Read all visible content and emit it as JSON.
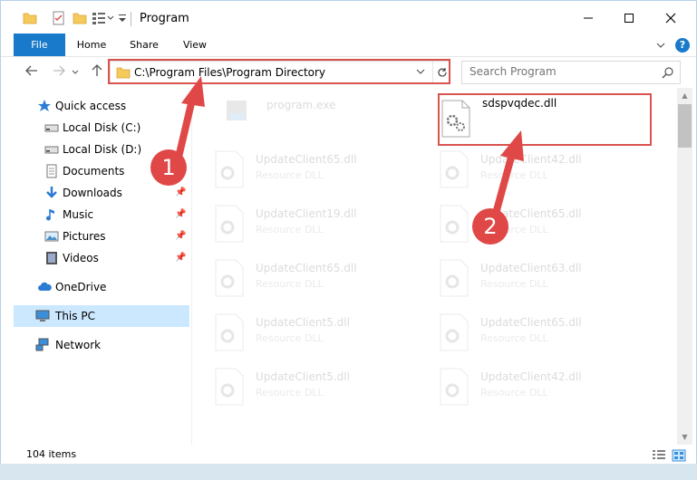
{
  "window": {
    "title": "Program"
  },
  "ribbon": {
    "tabs": [
      {
        "label": "File"
      },
      {
        "label": "Home"
      },
      {
        "label": "Share"
      },
      {
        "label": "View"
      }
    ],
    "help": "?"
  },
  "nav": {
    "address": "C:\\Program Files\\Program Directory",
    "search_placeholder": "Search Program"
  },
  "sidebar": {
    "items": [
      {
        "label": "Quick access",
        "icon": "star-icon"
      },
      {
        "label": "Local Disk (C:)",
        "icon": "drive-icon"
      },
      {
        "label": "Local Disk (D:)",
        "icon": "drive-icon"
      },
      {
        "label": "Documents",
        "icon": "documents-icon"
      },
      {
        "label": "Downloads",
        "icon": "download-icon"
      },
      {
        "label": "Music",
        "icon": "music-icon"
      },
      {
        "label": "Pictures",
        "icon": "pictures-icon"
      },
      {
        "label": "Videos",
        "icon": "videos-icon"
      },
      {
        "label": "OneDrive",
        "icon": "cloud-icon"
      },
      {
        "label": "This PC",
        "icon": "computer-icon"
      },
      {
        "label": "Network",
        "icon": "network-icon"
      }
    ]
  },
  "files": [
    {
      "name": "program.exe",
      "type": ""
    },
    {
      "name": "sdspvqdec.dll",
      "type": ""
    },
    {
      "name": "UpdateClient65.dll",
      "type": "Resource DLL"
    },
    {
      "name": "UpdateClient42.dll",
      "type": "Resource DLL"
    },
    {
      "name": "UpdateClient19.dll",
      "type": "Resource DLL"
    },
    {
      "name": "UpdateClient65.dll",
      "type": "Resource DLL"
    },
    {
      "name": "UpdateClient65.dll",
      "type": "Resource DLL"
    },
    {
      "name": "UpdateClient63.dll",
      "type": "Resource DLL"
    },
    {
      "name": "UpdateClient5.dll",
      "type": "Resource DLL"
    },
    {
      "name": "UpdateClient65.dll",
      "type": "Resource DLL"
    },
    {
      "name": "UpdateClient5.dll",
      "type": "Resource DLL"
    },
    {
      "name": "UpdateClient42.dll",
      "type": "Resource DLL"
    }
  ],
  "status": {
    "item_count": "104 items"
  },
  "callouts": [
    {
      "label": "1"
    },
    {
      "label": "2"
    }
  ],
  "colors": {
    "accent": "#1979ca",
    "highlight": "#d9534f",
    "callout": "#e04848",
    "selected": "#cce8ff"
  }
}
